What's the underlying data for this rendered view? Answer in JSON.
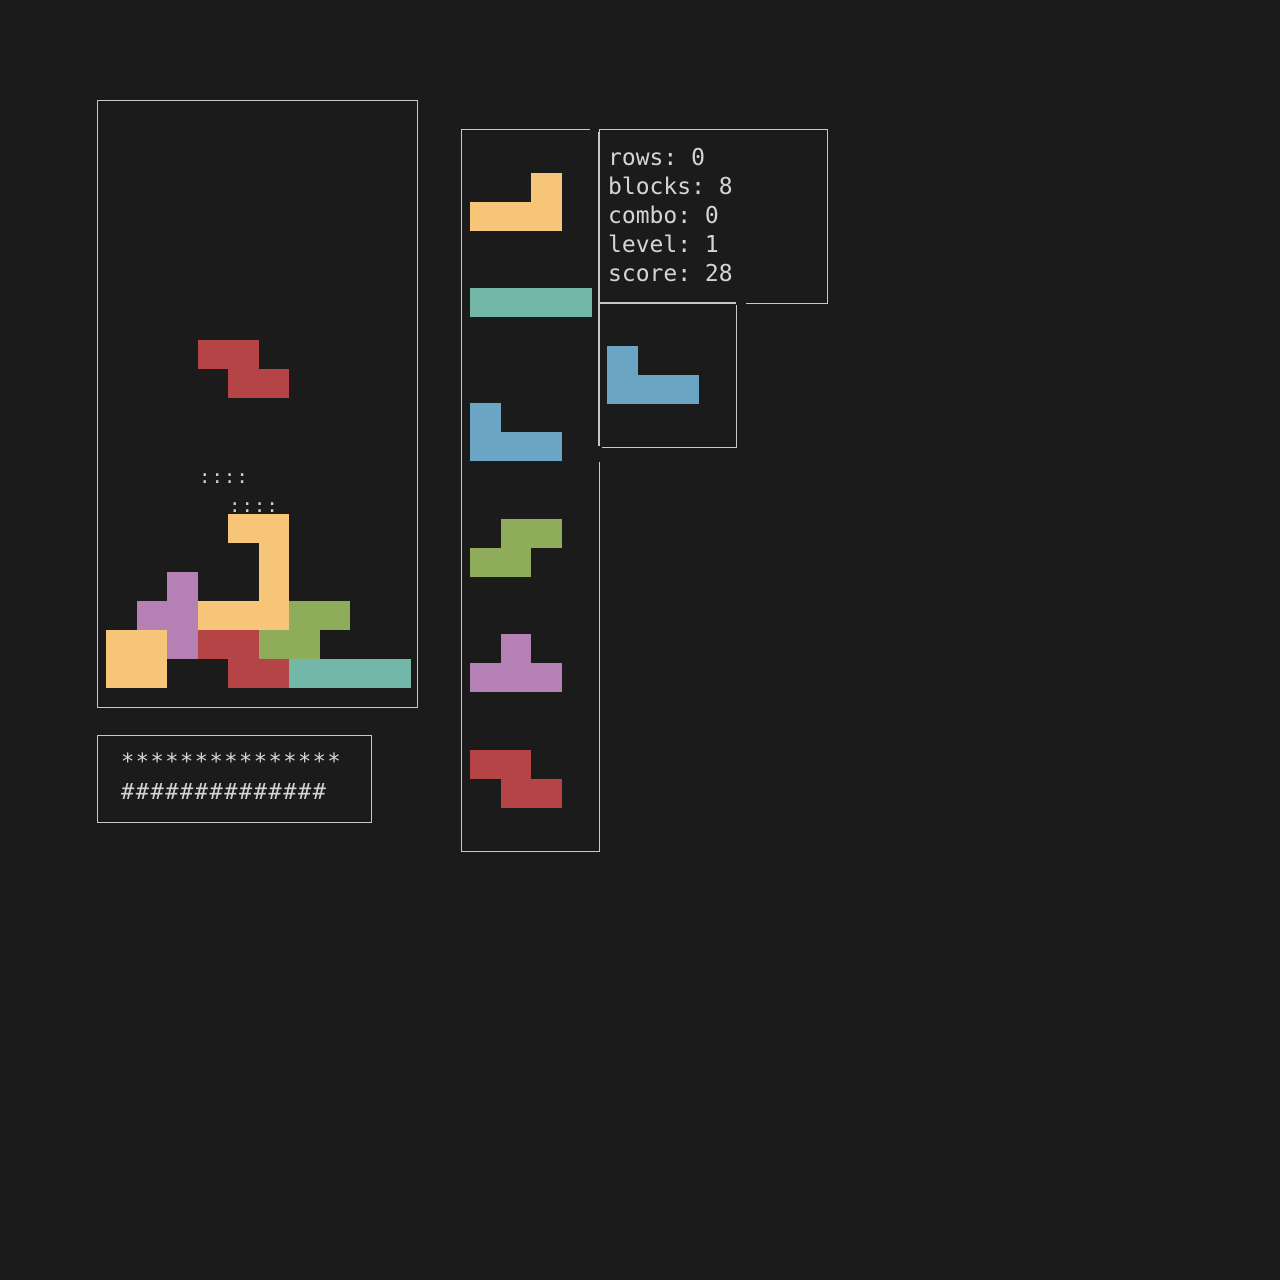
{
  "colors": {
    "background": "#1b1b1b",
    "border": "#c8c8c8",
    "text": "#d4d4d4",
    "O": "#f6c577",
    "L": "#f6c577",
    "I": "#73b7a9",
    "J": "#6aa6c3",
    "S": "#8fac5a",
    "T": "#b580b3",
    "Z": "#b54447"
  },
  "board": {
    "active_piece": {
      "type": "Z",
      "icon": "z-tetromino"
    },
    "ghost_marker": "::::"
  },
  "meter": {
    "line1": "***************",
    "line2": "##############"
  },
  "stats": {
    "rows": "rows: 0",
    "blocks": "blocks: 8",
    "combo": "combo: 0",
    "level": "level: 1",
    "score": "score: 28"
  },
  "queue": [
    {
      "type": "L",
      "icon": "l-tetromino"
    },
    {
      "type": "I",
      "icon": "i-tetromino"
    },
    {
      "type": "J",
      "icon": "j-tetromino"
    },
    {
      "type": "S",
      "icon": "s-tetromino"
    },
    {
      "type": "T",
      "icon": "t-tetromino"
    },
    {
      "type": "Z",
      "icon": "z-tetromino"
    }
  ],
  "hold": {
    "type": "J",
    "icon": "j-tetromino"
  }
}
